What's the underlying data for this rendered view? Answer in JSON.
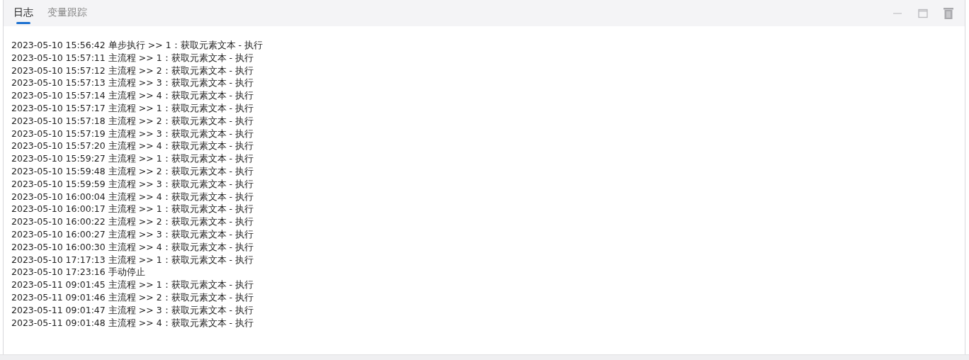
{
  "tabs": [
    {
      "label": "日志",
      "selected": true
    },
    {
      "label": "变量跟踪",
      "selected": false
    }
  ],
  "log_lines": [
    "2023-05-10 15:56:42 单步执行 >> 1：获取元素文本 - 执行",
    "2023-05-10 15:57:11 主流程 >> 1：获取元素文本 - 执行",
    "2023-05-10 15:57:12 主流程 >> 2：获取元素文本 - 执行",
    "2023-05-10 15:57:13 主流程 >> 3：获取元素文本 - 执行",
    "2023-05-10 15:57:14 主流程 >> 4：获取元素文本 - 执行",
    "2023-05-10 15:57:17 主流程 >> 1：获取元素文本 - 执行",
    "2023-05-10 15:57:18 主流程 >> 2：获取元素文本 - 执行",
    "2023-05-10 15:57:19 主流程 >> 3：获取元素文本 - 执行",
    "2023-05-10 15:57:20 主流程 >> 4：获取元素文本 - 执行",
    "2023-05-10 15:59:27 主流程 >> 1：获取元素文本 - 执行",
    "2023-05-10 15:59:48 主流程 >> 2：获取元素文本 - 执行",
    "2023-05-10 15:59:59 主流程 >> 3：获取元素文本 - 执行",
    "2023-05-10 16:00:04 主流程 >> 4：获取元素文本 - 执行",
    "2023-05-10 16:00:17 主流程 >> 1：获取元素文本 - 执行",
    "2023-05-10 16:00:22 主流程 >> 2：获取元素文本 - 执行",
    "2023-05-10 16:00:27 主流程 >> 3：获取元素文本 - 执行",
    "2023-05-10 16:00:30 主流程 >> 4：获取元素文本 - 执行",
    "2023-05-10 17:17:13 主流程 >> 1：获取元素文本 - 执行",
    "2023-05-10 17:23:16 手动停止",
    "2023-05-11 09:01:45 主流程 >> 1：获取元素文本 - 执行",
    "2023-05-11 09:01:46 主流程 >> 2：获取元素文本 - 执行",
    "2023-05-11 09:01:47 主流程 >> 3：获取元素文本 - 执行",
    "2023-05-11 09:01:48 主流程 >> 4：获取元素文本 - 执行"
  ]
}
